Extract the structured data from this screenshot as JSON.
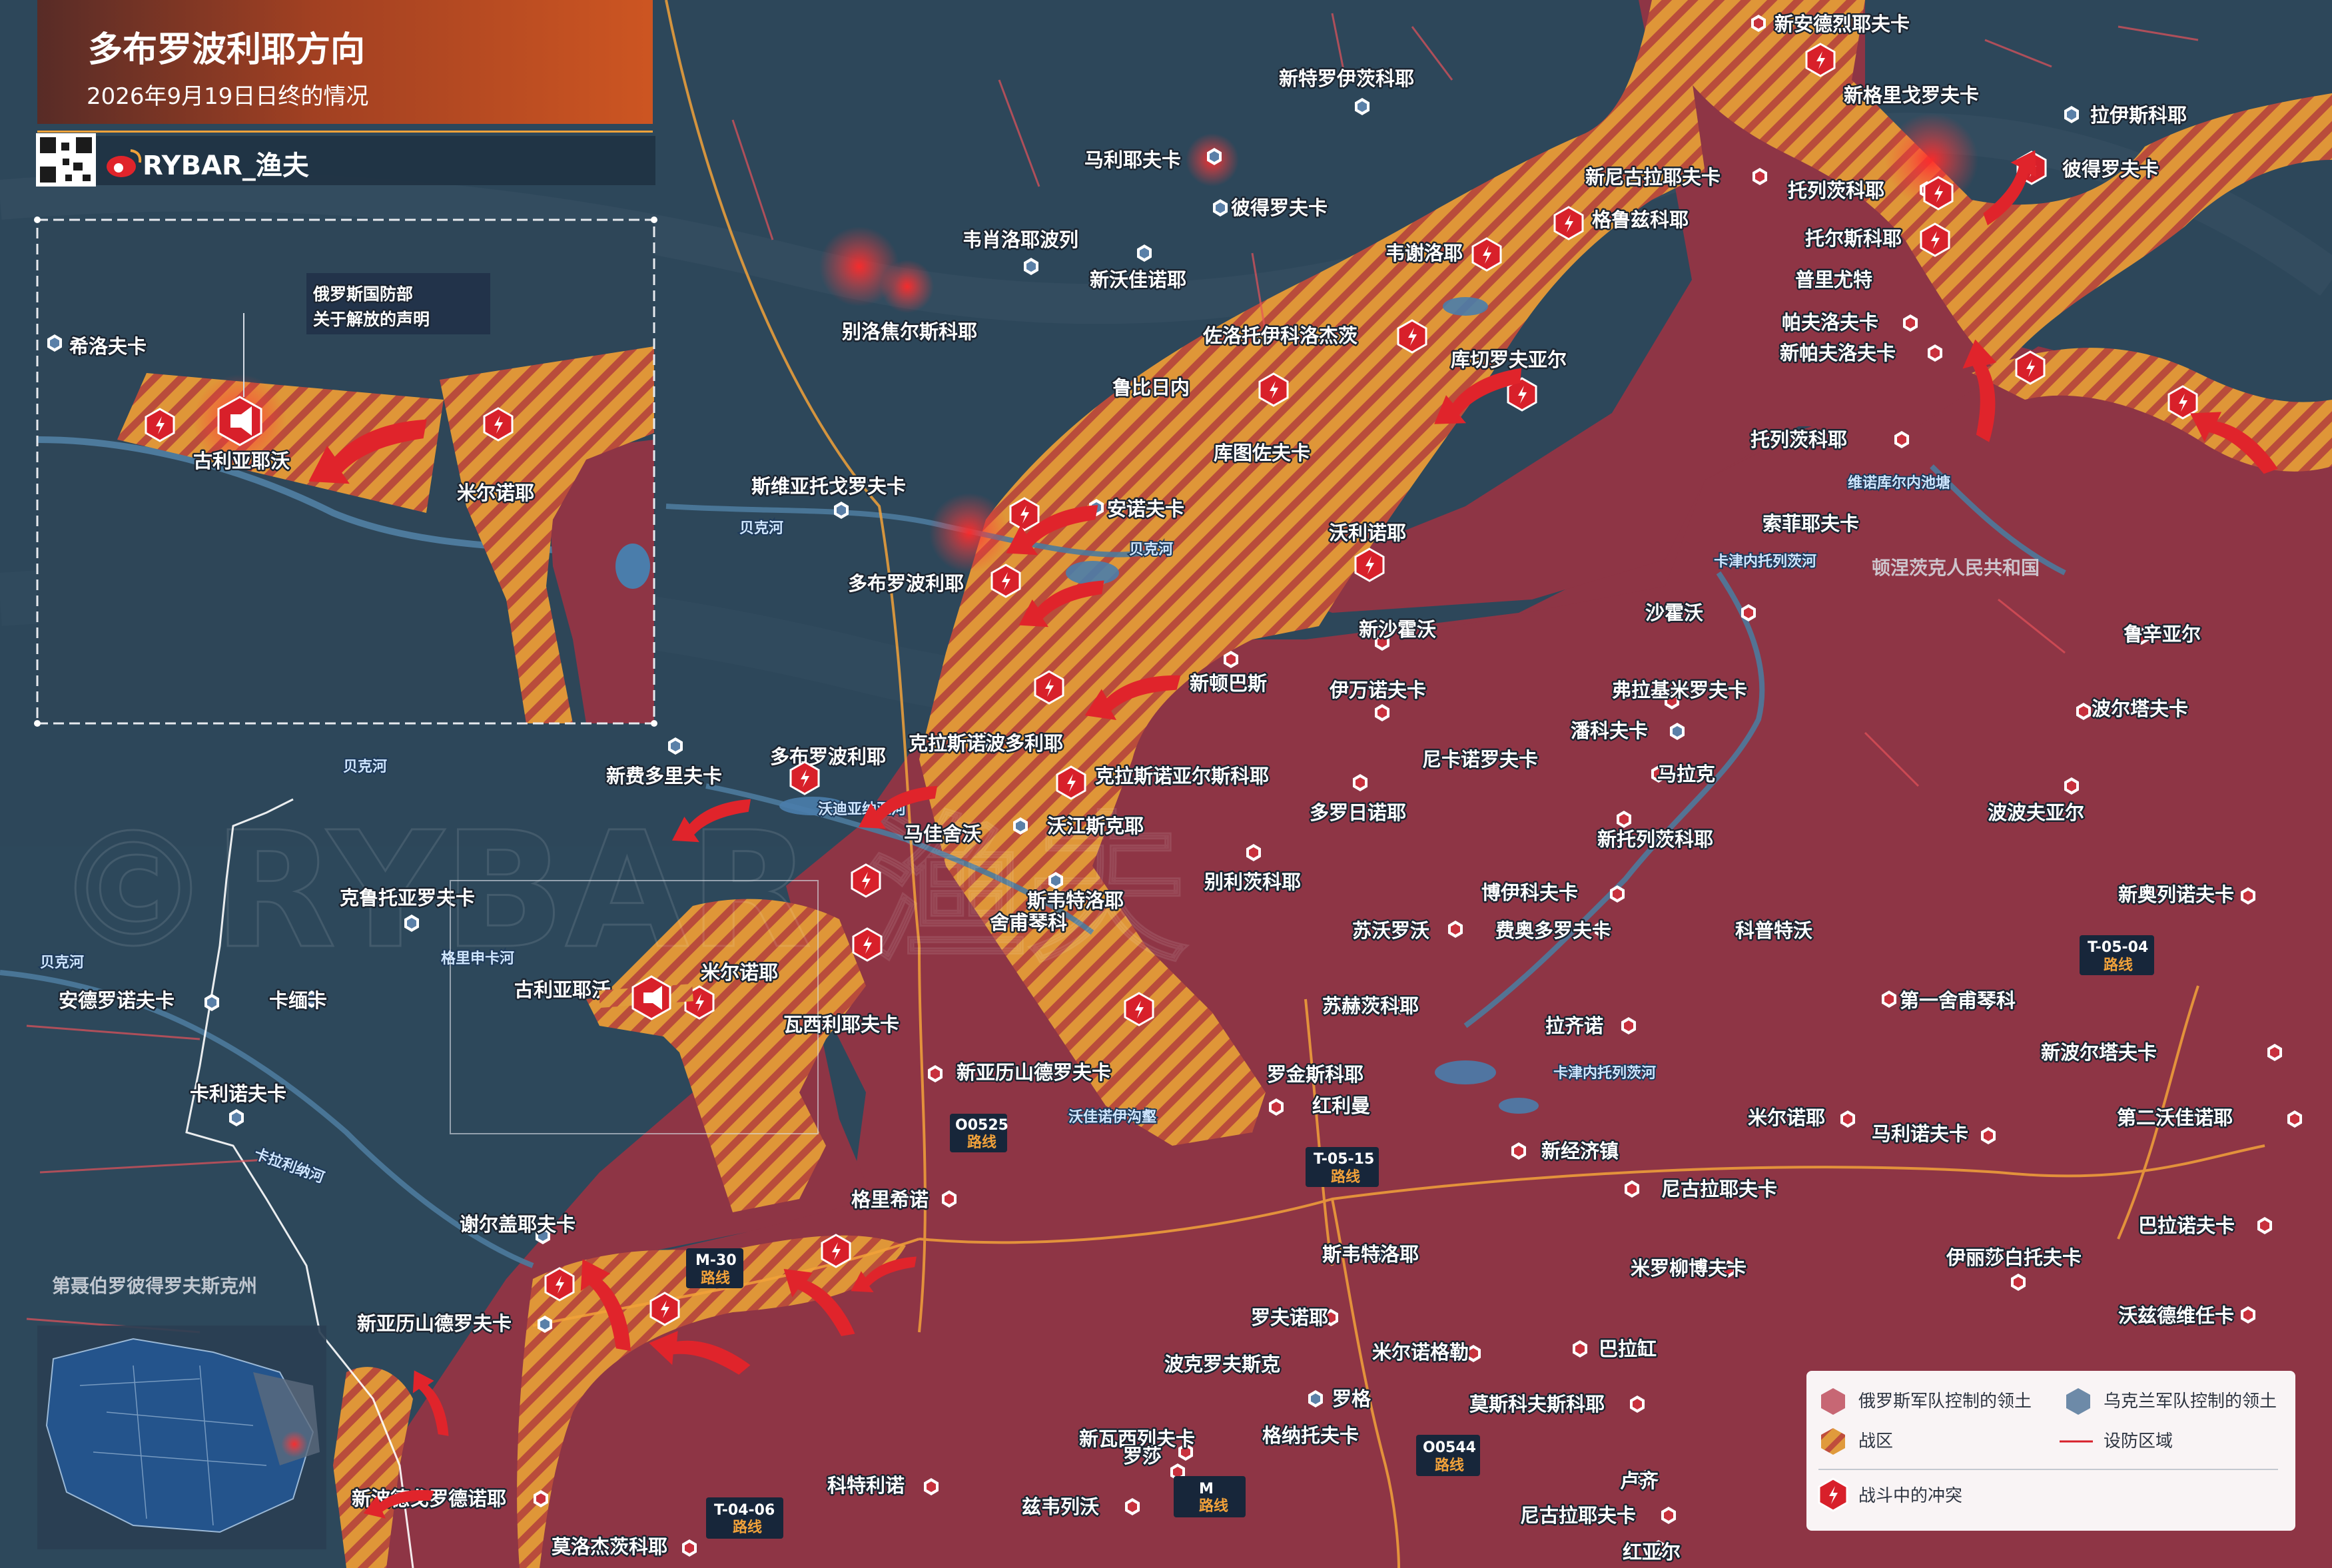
{
  "header": {
    "title": "多布罗波利耶方向",
    "subtitle": "2026年9月19日日终的情况",
    "brand": "RYBAR_渔夫"
  },
  "inset": {
    "statement": [
      "俄罗斯国防部",
      "关于解放的声明"
    ],
    "labels": {
      "khisl": "希洛夫卡",
      "gul": "古利亚耶沃",
      "mir": "米尔诺耶"
    }
  },
  "places": [
    {
      "id": "novo-andreevka",
      "name": "新安德烈耶夫卡"
    },
    {
      "id": "novo-triroitske",
      "name": "新特罗伊茨科耶"
    },
    {
      "id": "novo-grigorivka",
      "name": "新格里戈罗夫卡"
    },
    {
      "id": "rai-yisivka",
      "name": "拉伊斯科耶"
    },
    {
      "id": "marievka",
      "name": "马利耶夫卡"
    },
    {
      "id": "novonikolaevka",
      "name": "新尼古拉耶夫卡"
    },
    {
      "id": "torets",
      "name": "托列茨科耶"
    },
    {
      "id": "petrovka-e",
      "name": "彼得罗夫卡"
    },
    {
      "id": "petrovka-n",
      "name": "彼得罗夫卡"
    },
    {
      "id": "vesheloyevka",
      "name": "韦肖洛耶波列"
    },
    {
      "id": "grigorivka",
      "name": "格鲁兹科耶"
    },
    {
      "id": "toretske",
      "name": "托尔斯科耶"
    },
    {
      "id": "veselo",
      "name": "韦谢洛耶"
    },
    {
      "id": "novovasilevka",
      "name": "新沃佳诺耶"
    },
    {
      "id": "purivka",
      "name": "普里尤特"
    },
    {
      "id": "belozers",
      "name": "别洛焦尔斯科耶"
    },
    {
      "id": "zolotoy",
      "name": "佐洛托伊科洛杰茨"
    },
    {
      "id": "kuchev",
      "name": "库切罗夫亚尔"
    },
    {
      "id": "pavlovka",
      "name": "帕夫洛夫卡"
    },
    {
      "id": "novopavlovka",
      "name": "新帕夫洛夫卡"
    },
    {
      "id": "rubizhne",
      "name": "鲁比日内"
    },
    {
      "id": "kutuzov",
      "name": "库图佐夫卡"
    },
    {
      "id": "tolstoy",
      "name": "托列茨科耶"
    },
    {
      "id": "sviat",
      "name": "斯维亚托戈罗夫卡"
    },
    {
      "id": "annovka",
      "name": "安诺夫卡"
    },
    {
      "id": "sofievka",
      "name": "索菲耶夫卡"
    },
    {
      "id": "dobro",
      "name": "多布罗波利耶"
    },
    {
      "id": "vol",
      "name": "沃利诺耶"
    },
    {
      "id": "novoshah",
      "name": "新沙霍沃"
    },
    {
      "id": "shah",
      "name": "沙霍沃"
    },
    {
      "id": "rusin",
      "name": "鲁辛亚尔"
    },
    {
      "id": "novodon",
      "name": "新顿巴斯"
    },
    {
      "id": "ivan",
      "name": "伊万诺夫卡"
    },
    {
      "id": "vladimir",
      "name": "弗拉基米罗夫卡"
    },
    {
      "id": "polt",
      "name": "波尔塔夫卡"
    },
    {
      "id": "pank",
      "name": "潘科夫卡"
    },
    {
      "id": "novofed",
      "name": "新费多里夫卡"
    },
    {
      "id": "dobro2",
      "name": "多布罗波利耶"
    },
    {
      "id": "kras",
      "name": "克拉斯诺波多利耶"
    },
    {
      "id": "krasna",
      "name": "克拉斯诺亚尔斯科耶"
    },
    {
      "id": "nikan",
      "name": "尼卡诺罗夫卡"
    },
    {
      "id": "malak",
      "name": "马拉克"
    },
    {
      "id": "dolg",
      "name": "多罗日诺耶"
    },
    {
      "id": "popov",
      "name": "波波夫亚尔"
    },
    {
      "id": "majias",
      "name": "马佳舍沃"
    },
    {
      "id": "vod",
      "name": "沃江斯克耶"
    },
    {
      "id": "novotor",
      "name": "新托列茨科耶"
    },
    {
      "id": "kruto",
      "name": "克鲁托亚罗夫卡"
    },
    {
      "id": "svyat",
      "name": "斯韦特洛耶"
    },
    {
      "id": "shev",
      "name": "舍甫琴科"
    },
    {
      "id": "bel",
      "name": "别利茨科耶"
    },
    {
      "id": "boevoy",
      "name": "博伊科夫卡"
    },
    {
      "id": "novoorl",
      "name": "新奥列诺夫卡"
    },
    {
      "id": "suvor",
      "name": "苏沃罗沃"
    },
    {
      "id": "fedor",
      "name": "费奥多罗夫卡"
    },
    {
      "id": "kipr",
      "name": "科普特沃"
    },
    {
      "id": "andro",
      "name": "安德罗诺夫卡"
    },
    {
      "id": "kam",
      "name": "卡缅卡"
    },
    {
      "id": "gul2",
      "name": "古利亚耶沃"
    },
    {
      "id": "mir2",
      "name": "米尔诺耶"
    },
    {
      "id": "sukh",
      "name": "苏赫茨科耶"
    },
    {
      "id": "shev2",
      "name": "第一舍甫琴科"
    },
    {
      "id": "vasil",
      "name": "瓦西利耶夫卡"
    },
    {
      "id": "lastoch",
      "name": "拉齐诺"
    },
    {
      "id": "novobor",
      "name": "新波尔塔夫卡"
    },
    {
      "id": "kalinov",
      "name": "卡利诺夫卡"
    },
    {
      "id": "novoalex",
      "name": "新亚历山德罗夫卡"
    },
    {
      "id": "rodin",
      "name": "罗金斯科耶"
    },
    {
      "id": "krasn",
      "name": "红利曼"
    },
    {
      "id": "mirnoe",
      "name": "米尔诺耶"
    },
    {
      "id": "malin",
      "name": "马利诺夫卡"
    },
    {
      "id": "vtoroy",
      "name": "第二沃佳诺耶"
    },
    {
      "id": "gris",
      "name": "格里希诺"
    },
    {
      "id": "novoeco",
      "name": "新经济镇"
    },
    {
      "id": "nikol",
      "name": "尼古拉耶夫卡"
    },
    {
      "id": "serg",
      "name": "谢尔盖耶夫卡"
    },
    {
      "id": "svet",
      "name": "斯韦特洛耶"
    },
    {
      "id": "myrol",
      "name": "米罗柳博夫卡"
    },
    {
      "id": "ilinka",
      "name": "伊丽莎白托夫卡"
    },
    {
      "id": "barato",
      "name": "巴拉诺夫卡"
    },
    {
      "id": "novoalex2",
      "name": "新亚历山德罗夫卡"
    },
    {
      "id": "rivne",
      "name": "罗夫诺耶"
    },
    {
      "id": "mirnograd",
      "name": "米尔诺格勒"
    },
    {
      "id": "balak",
      "name": "巴拉缸"
    },
    {
      "id": "zvez",
      "name": "沃兹德维任卡"
    },
    {
      "id": "pokrovsk",
      "name": "波克罗夫斯克"
    },
    {
      "id": "rog",
      "name": "罗格"
    },
    {
      "id": "moskov",
      "name": "莫斯科夫斯科耶"
    },
    {
      "id": "novovasil",
      "name": "新瓦西列夫卡"
    },
    {
      "id": "rosa",
      "name": "罗莎"
    },
    {
      "id": "granit",
      "name": "格纳托夫卡"
    },
    {
      "id": "kotli",
      "name": "科特利诺"
    },
    {
      "id": "zvir",
      "name": "兹韦列沃"
    },
    {
      "id": "lucz",
      "name": "卢齐"
    },
    {
      "id": "nikol2",
      "name": "尼古拉耶夫卡"
    },
    {
      "id": "moloch",
      "name": "莫洛杰茨科耶"
    },
    {
      "id": "krasnyar",
      "name": "红亚尔"
    },
    {
      "id": "novopodol",
      "name": "新波德戈罗德诺耶"
    }
  ],
  "rivers": {
    "byk1": "贝克河",
    "byk2": "贝克河",
    "byk3": "贝克河",
    "byk4": "贝克河",
    "vodina": "沃迪亚纳亚河",
    "grish": "格里申卡河",
    "kalad": "卡拉利纳河",
    "ktorets1": "卡津内托列茨河",
    "ktorets2": "卡津内托列茨河",
    "reservoir": "维诺库尔内池塘",
    "gully": "沃佳诺伊沟壑"
  },
  "regions": {
    "donetsk": "顿涅茨克人民共和国",
    "dnipro": "第聂伯罗彼得罗夫斯克州"
  },
  "roads": [
    {
      "code": "O0525",
      "word": "路线"
    },
    {
      "code": "T-05-15",
      "word": "路线"
    },
    {
      "code": "M-30",
      "word": "路线"
    },
    {
      "code": "O0544",
      "word": "路线"
    },
    {
      "code": "T-04-06",
      "word": "路线"
    },
    {
      "code": "T-05-04",
      "word": "路线"
    },
    {
      "code": "M",
      "word": "路线"
    }
  ],
  "legend": {
    "ru_control": "俄罗斯军队控制的领土",
    "ua_control": "乌克兰军队控制的领土",
    "combat_zone": "战区",
    "defense_line": "设防区域",
    "clash": "战斗中的冲突"
  },
  "colors": {
    "ru_territory": "#8e3545",
    "ua_territory": "#2c4559",
    "combat_zone": "#d9913a",
    "arrow": "#e0242b",
    "header_bg": "#c44a22"
  }
}
